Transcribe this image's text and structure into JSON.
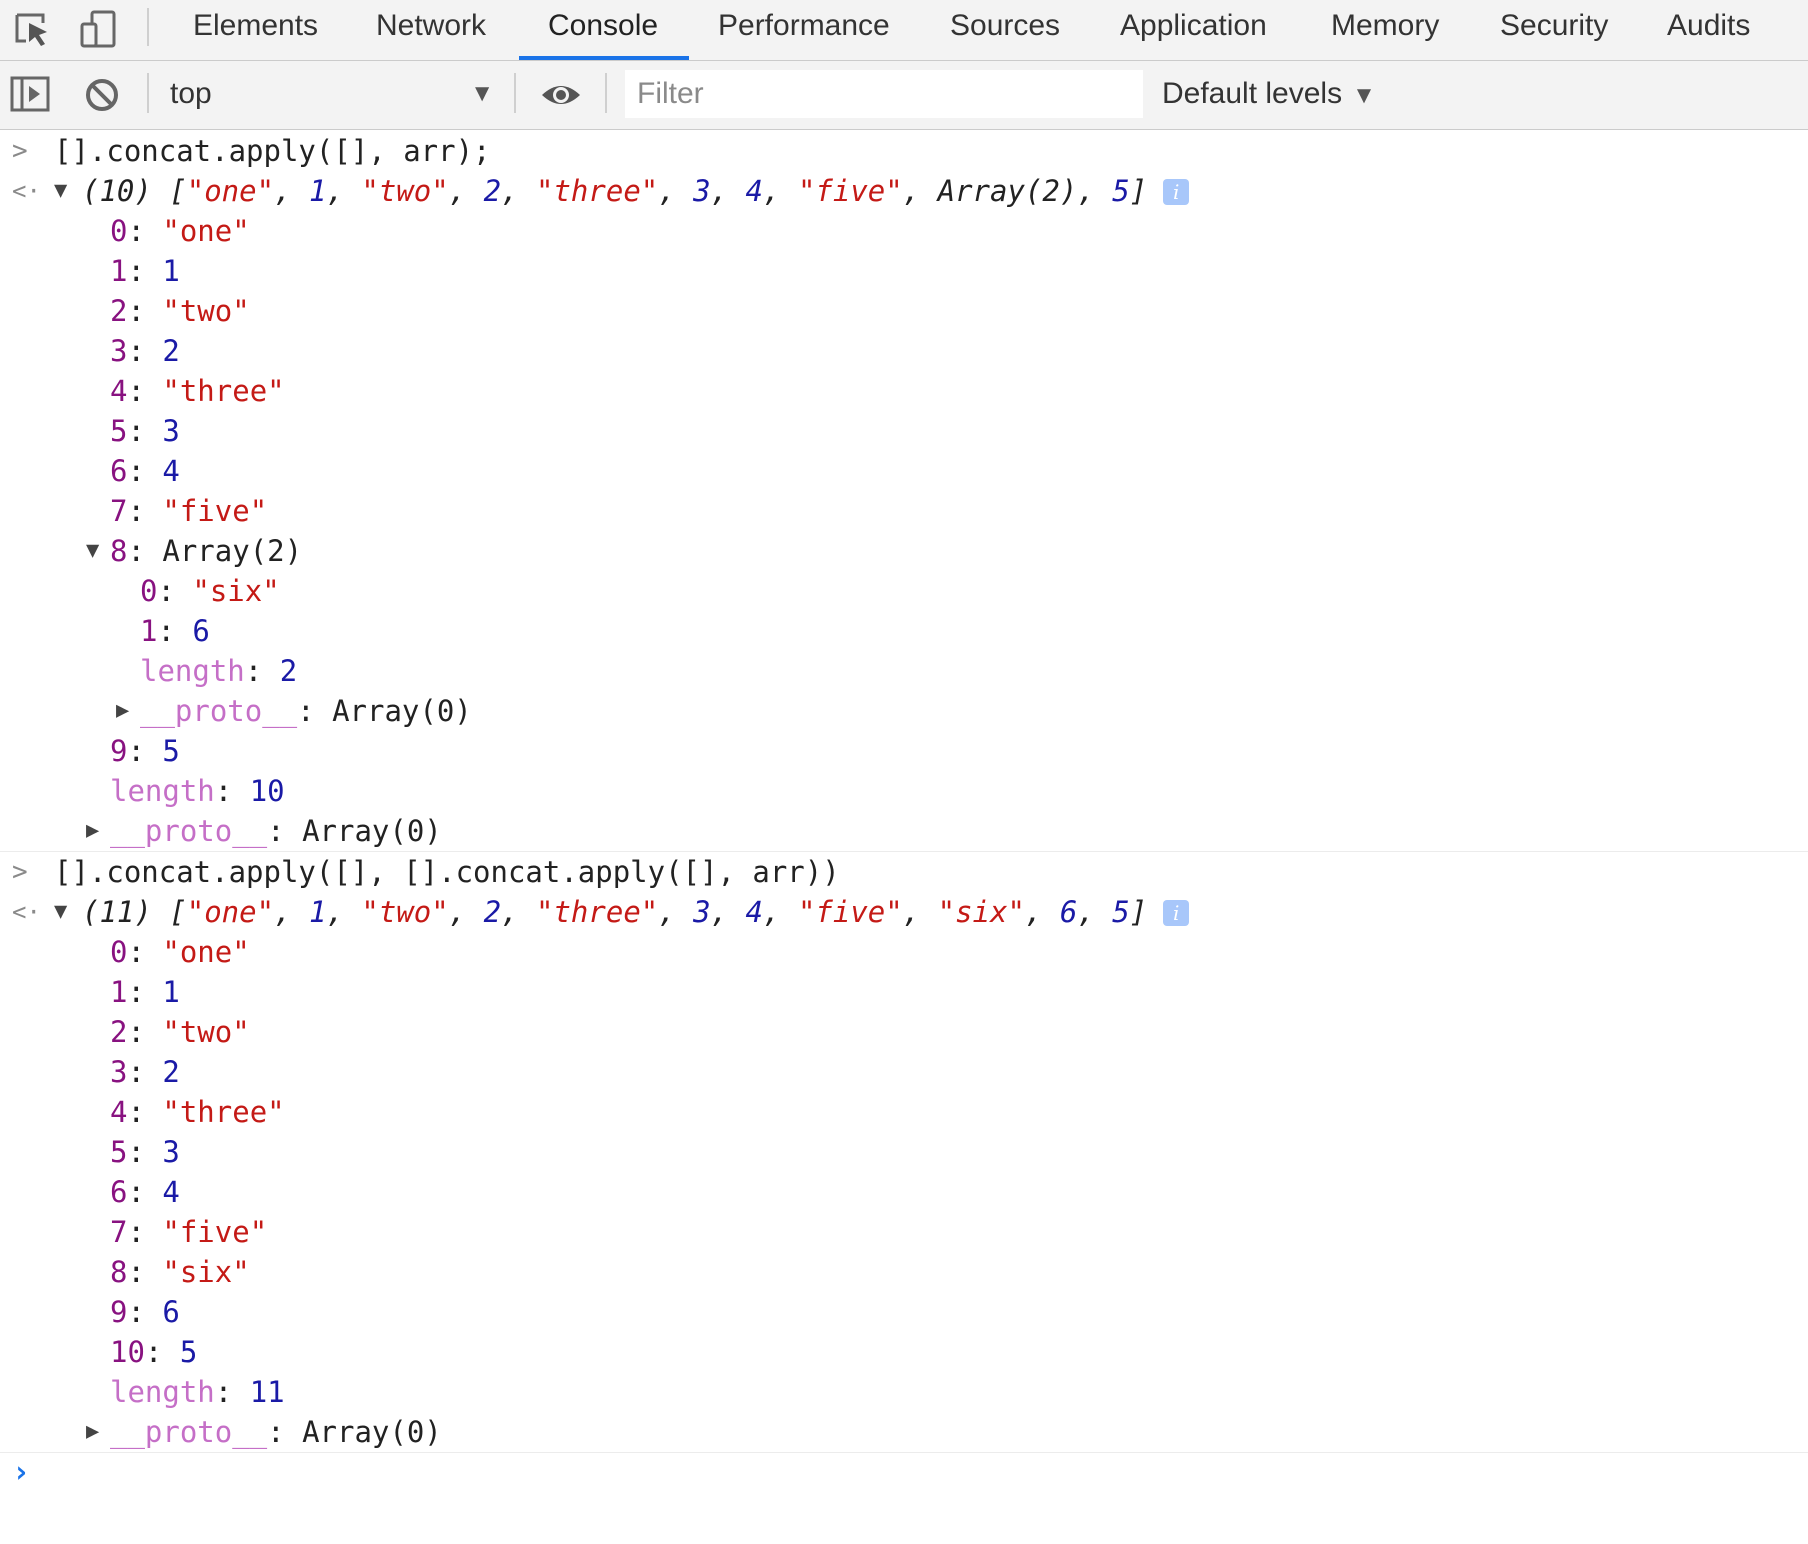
{
  "tabs": [
    {
      "label": "Elements",
      "active": false
    },
    {
      "label": "Network",
      "active": false
    },
    {
      "label": "Console",
      "active": true
    },
    {
      "label": "Performance",
      "active": false
    },
    {
      "label": "Sources",
      "active": false
    },
    {
      "label": "Application",
      "active": false
    },
    {
      "label": "Memory",
      "active": false
    },
    {
      "label": "Security",
      "active": false
    },
    {
      "label": "Audits",
      "active": false
    }
  ],
  "toolbar": {
    "context": "top",
    "filter_placeholder": "Filter",
    "filter_value": "",
    "levels_label": "Default levels"
  },
  "colors": {
    "accent": "#1a73e8",
    "key": "#881280",
    "string": "#c41a16",
    "number": "#1a1aa6",
    "length_key": "#c56fc7"
  },
  "console": {
    "entries": [
      {
        "command": "[].concat.apply([], arr);",
        "preview_count": "(10)",
        "preview_items": [
          {
            "text": "\"one\"",
            "type": "s"
          },
          {
            "text": "1",
            "type": "n"
          },
          {
            "text": "\"two\"",
            "type": "s"
          },
          {
            "text": "2",
            "type": "n"
          },
          {
            "text": "\"three\"",
            "type": "s"
          },
          {
            "text": "3",
            "type": "n"
          },
          {
            "text": "4",
            "type": "n"
          },
          {
            "text": "\"five\"",
            "type": "s"
          },
          {
            "text": "Array(2)",
            "type": "o"
          },
          {
            "text": "5",
            "type": "n"
          }
        ],
        "rows": [
          {
            "indent": 0,
            "key": "0",
            "value": "\"one\"",
            "vtype": "s"
          },
          {
            "indent": 0,
            "key": "1",
            "value": "1",
            "vtype": "n"
          },
          {
            "indent": 0,
            "key": "2",
            "value": "\"two\"",
            "vtype": "s"
          },
          {
            "indent": 0,
            "key": "3",
            "value": "2",
            "vtype": "n"
          },
          {
            "indent": 0,
            "key": "4",
            "value": "\"three\"",
            "vtype": "s"
          },
          {
            "indent": 0,
            "key": "5",
            "value": "3",
            "vtype": "n"
          },
          {
            "indent": 0,
            "key": "6",
            "value": "4",
            "vtype": "n"
          },
          {
            "indent": 0,
            "key": "7",
            "value": "\"five\"",
            "vtype": "s"
          },
          {
            "indent": 0,
            "key": "8",
            "value": "Array(2)",
            "vtype": "o",
            "expander": "expanded"
          },
          {
            "indent": 1,
            "key": "0",
            "value": "\"six\"",
            "vtype": "s"
          },
          {
            "indent": 1,
            "key": "1",
            "value": "6",
            "vtype": "n"
          },
          {
            "indent": 1,
            "key": "length",
            "value": "2",
            "vtype": "n",
            "ktype": "klen"
          },
          {
            "indent": 1,
            "key": "__proto__",
            "value": "Array(0)",
            "vtype": "o",
            "ktype": "klen",
            "expander": "collapsed"
          },
          {
            "indent": 0,
            "key": "9",
            "value": "5",
            "vtype": "n"
          },
          {
            "indent": 0,
            "key": "length",
            "value": "10",
            "vtype": "n",
            "ktype": "klen"
          },
          {
            "indent": 0,
            "key": "__proto__",
            "value": "Array(0)",
            "vtype": "o",
            "ktype": "klen",
            "expander": "collapsed"
          }
        ]
      },
      {
        "command": "[].concat.apply([], [].concat.apply([], arr))",
        "preview_count": "(11)",
        "preview_items": [
          {
            "text": "\"one\"",
            "type": "s"
          },
          {
            "text": "1",
            "type": "n"
          },
          {
            "text": "\"two\"",
            "type": "s"
          },
          {
            "text": "2",
            "type": "n"
          },
          {
            "text": "\"three\"",
            "type": "s"
          },
          {
            "text": "3",
            "type": "n"
          },
          {
            "text": "4",
            "type": "n"
          },
          {
            "text": "\"five\"",
            "type": "s"
          },
          {
            "text": "\"six\"",
            "type": "s"
          },
          {
            "text": "6",
            "type": "n"
          },
          {
            "text": "5",
            "type": "n"
          }
        ],
        "rows": [
          {
            "indent": 0,
            "key": "0",
            "value": "\"one\"",
            "vtype": "s"
          },
          {
            "indent": 0,
            "key": "1",
            "value": "1",
            "vtype": "n"
          },
          {
            "indent": 0,
            "key": "2",
            "value": "\"two\"",
            "vtype": "s"
          },
          {
            "indent": 0,
            "key": "3",
            "value": "2",
            "vtype": "n"
          },
          {
            "indent": 0,
            "key": "4",
            "value": "\"three\"",
            "vtype": "s"
          },
          {
            "indent": 0,
            "key": "5",
            "value": "3",
            "vtype": "n"
          },
          {
            "indent": 0,
            "key": "6",
            "value": "4",
            "vtype": "n"
          },
          {
            "indent": 0,
            "key": "7",
            "value": "\"five\"",
            "vtype": "s"
          },
          {
            "indent": 0,
            "key": "8",
            "value": "\"six\"",
            "vtype": "s"
          },
          {
            "indent": 0,
            "key": "9",
            "value": "6",
            "vtype": "n"
          },
          {
            "indent": 0,
            "key": "10",
            "value": "5",
            "vtype": "n"
          },
          {
            "indent": 0,
            "key": "length",
            "value": "11",
            "vtype": "n",
            "ktype": "klen"
          },
          {
            "indent": 0,
            "key": "__proto__",
            "value": "Array(0)",
            "vtype": "o",
            "ktype": "klen",
            "expander": "collapsed"
          }
        ]
      }
    ]
  }
}
